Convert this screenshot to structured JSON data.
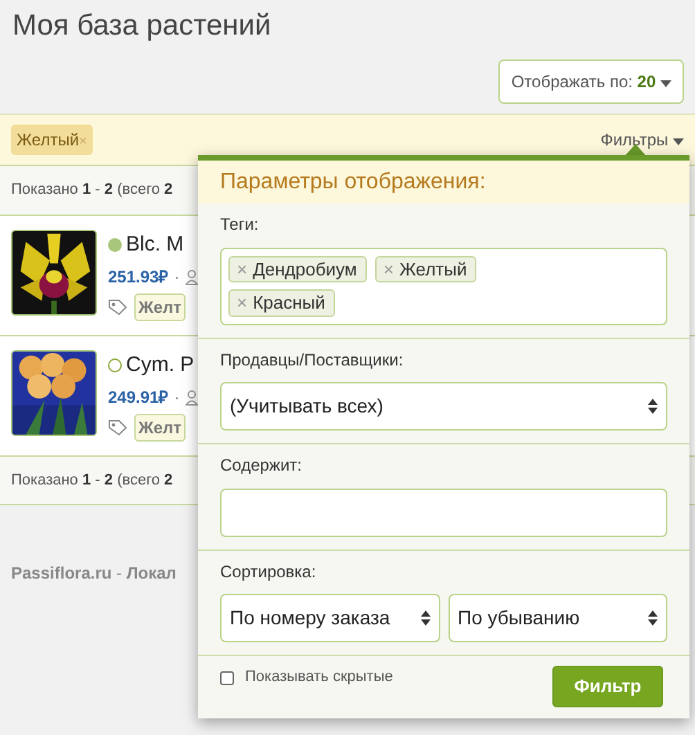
{
  "page_title": "Моя база растений",
  "per_page": {
    "label": "Отображать по:",
    "value": "20"
  },
  "active_tags": [
    {
      "label": "Желтый",
      "remove": "×"
    }
  ],
  "filters_toggle": {
    "label": "Фильтры",
    "expanded": true
  },
  "summary_top": "Показано **1** - **2** (всего **2**",
  "plants": [
    {
      "name": "Blc. M",
      "active": true,
      "price": "251.93₽",
      "sep": "·",
      "tag": "Желт"
    },
    {
      "name": "Cym. P",
      "active": false,
      "price": "249.91₽",
      "sep": "·",
      "tag": "Желт"
    }
  ],
  "summary_bottom": "Показано **1** - **2** (всего **2**",
  "footer": "**Passiflora.ru** - **Локал**",
  "popover": {
    "title": "Параметры отображения:",
    "tags_label": "Теги:",
    "tags": [
      {
        "label": "Дендробиум",
        "remove": "×"
      },
      {
        "label": "Желтый",
        "remove": "×"
      },
      {
        "label": "Красный",
        "remove": "×"
      }
    ],
    "sellers_label": "Продавцы/Поставщики:",
    "sellers_value": "(Учитывать всех)",
    "contains_label": "Содержит:",
    "sort_label": "Сортировка:",
    "sort_by": "По номеру заказа",
    "sort_order": "По убыванию",
    "show_hidden": {
      "label": "Показывать скрытые",
      "checked": false
    },
    "submit": "Фильтр"
  }
}
